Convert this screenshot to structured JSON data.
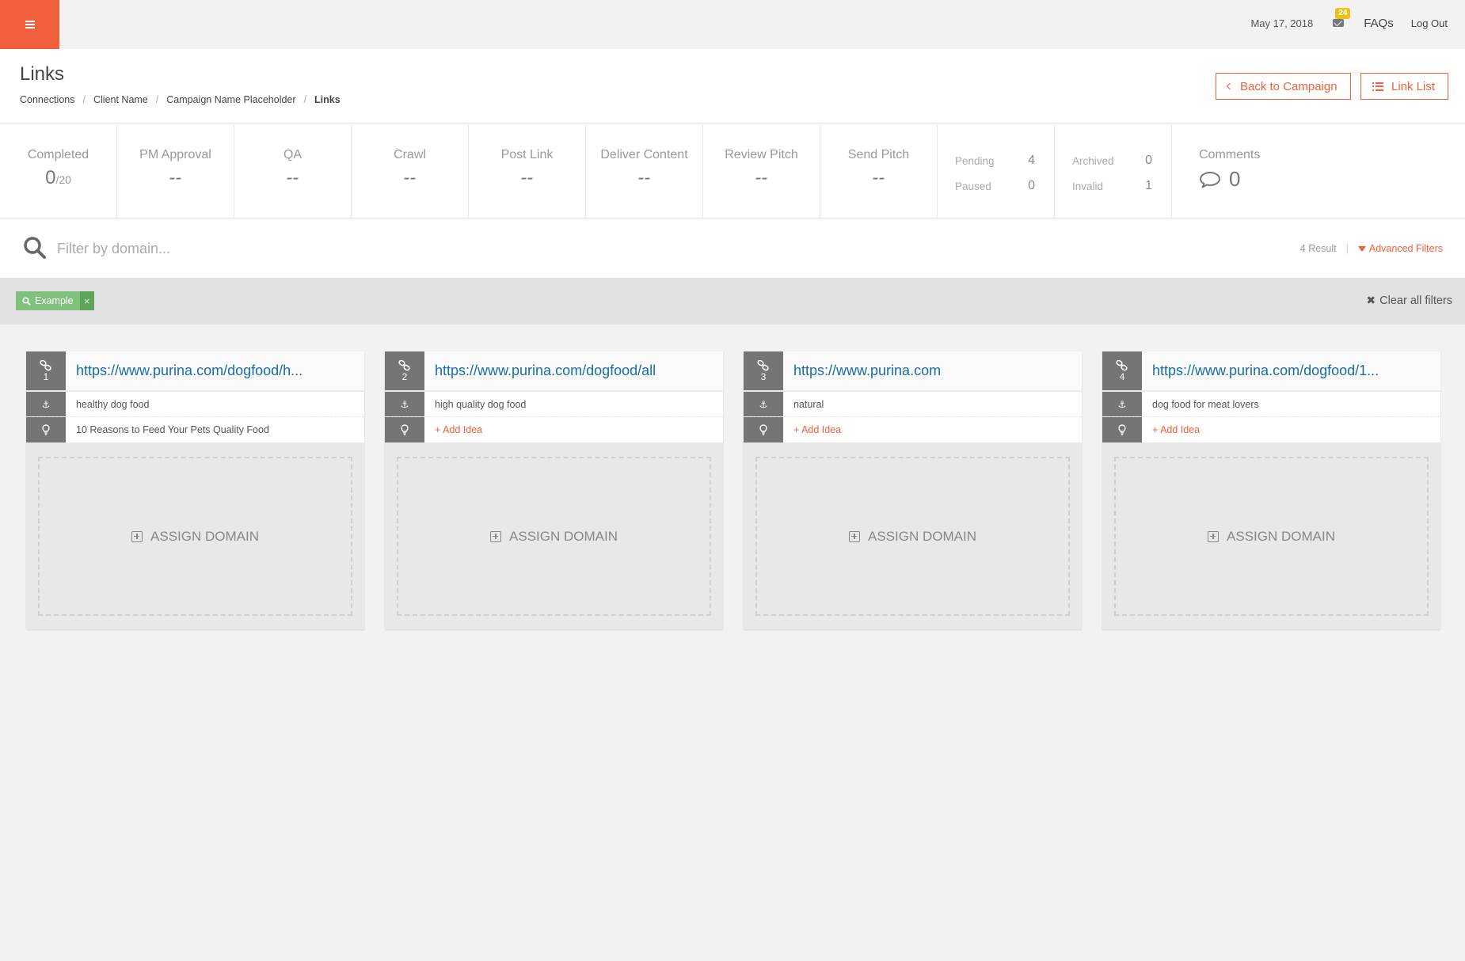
{
  "topbar": {
    "date": "May 17, 2018",
    "mail_badge": "24",
    "faqs": "FAQs",
    "logout": "Log Out"
  },
  "header": {
    "title": "Links",
    "breadcrumb": [
      "Connections",
      "Client Name",
      "Campaign Name Placeholder",
      "Links"
    ],
    "back_button": "Back to Campaign",
    "list_button": "Link List"
  },
  "stats": {
    "completed": {
      "label": "Completed",
      "value": "0",
      "total": "/20"
    },
    "pm_approval": {
      "label": "PM Approval",
      "value": "--"
    },
    "qa": {
      "label": "QA",
      "value": "--"
    },
    "crawl": {
      "label": "Crawl",
      "value": "--"
    },
    "post_link": {
      "label": "Post Link",
      "value": "--"
    },
    "deliver_content": {
      "label": "Deliver Content",
      "value": "--"
    },
    "review_pitch": {
      "label": "Review Pitch",
      "value": "--"
    },
    "send_pitch": {
      "label": "Send Pitch",
      "value": "--"
    },
    "pending": {
      "label": "Pending",
      "value": "4"
    },
    "paused": {
      "label": "Paused",
      "value": "0"
    },
    "archived": {
      "label": "Archived",
      "value": "0"
    },
    "invalid": {
      "label": "Invalid",
      "value": "1"
    },
    "comments": {
      "label": "Comments",
      "value": "0"
    }
  },
  "search": {
    "placeholder": "Filter by domain...",
    "result_count": "4 Result",
    "separator": "|",
    "advanced_filters": "Advanced Filters"
  },
  "filters": {
    "chip_label": "Example",
    "chip_remove": "×",
    "clear_all": "Clear all filters"
  },
  "cards": [
    {
      "number": "1",
      "url": "https://www.purina.com/dogfood/h...",
      "anchor": "healthy dog food",
      "idea": "10 Reasons to Feed Your Pets Quality Food",
      "idea_is_add": false,
      "assign": "ASSIGN DOMAIN"
    },
    {
      "number": "2",
      "url": "https://www.purina.com/dogfood/all",
      "anchor": "high quality dog food",
      "idea": "+ Add Idea",
      "idea_is_add": true,
      "assign": "ASSIGN DOMAIN"
    },
    {
      "number": "3",
      "url": "https://www.purina.com",
      "anchor": "natural",
      "idea": "+ Add Idea",
      "idea_is_add": true,
      "assign": "ASSIGN DOMAIN"
    },
    {
      "number": "4",
      "url": "https://www.purina.com/dogfood/1...",
      "anchor": "dog food for meat lovers",
      "idea": "+ Add Idea",
      "idea_is_add": true,
      "assign": "ASSIGN DOMAIN"
    }
  ],
  "colors": {
    "accent": "#f0603a",
    "link": "#1a6ca8",
    "chip": "#7fc17d",
    "badge": "#e8c31a"
  }
}
